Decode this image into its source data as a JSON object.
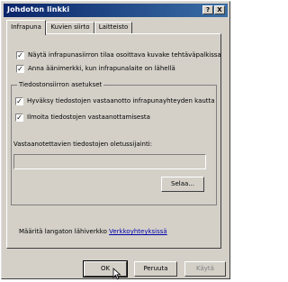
{
  "window": {
    "title": "Johdoton linkki",
    "help_label": "?",
    "close_label": "X"
  },
  "tabs": [
    {
      "label": "Infrapuna"
    },
    {
      "label": "Kuvien siirto"
    },
    {
      "label": "Laitteisto"
    }
  ],
  "options": {
    "tray_icon_label": "Näytä infrapunasiirron tilaa osoittava kuvake tehtäväpalkissa",
    "tray_icon_checked": true,
    "sound_label": "Anna äänimerkki, kun infrapunalaite on lähellä",
    "sound_checked": true
  },
  "transfer_settings": {
    "group_title": "Tiedostonsiirron asetukset",
    "accept_label": "Hyväksy tiedostojen vastaanotto infrapunayhteyden kautta",
    "accept_checked": true,
    "notify_label": "Ilmoita tiedostojen vastaanottamisesta",
    "notify_checked": true,
    "default_location_label": "Vastaanotettavien tiedostojen oletussijainti:",
    "default_location_value": "",
    "browse_label": "Selaa..."
  },
  "wireless": {
    "text": "Määritä langaton lähiverkko",
    "link_label": "Verkkoyhteyksissä"
  },
  "footer": {
    "ok_label": "OK",
    "cancel_label": "Peruuta",
    "apply_label": "Käytä"
  },
  "check_mark": "✓"
}
